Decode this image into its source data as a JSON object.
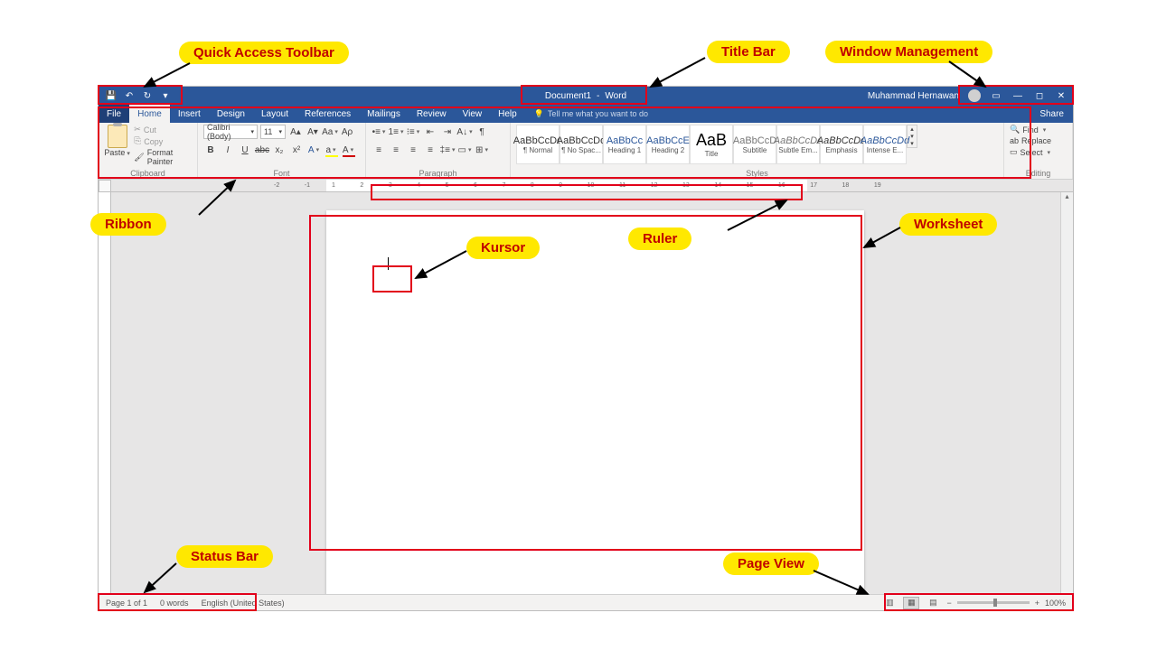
{
  "titlebar": {
    "doc_title": "Document1",
    "app_name": "Word",
    "user": "Muhammad Hernawan"
  },
  "tabs": {
    "file": "File",
    "home": "Home",
    "insert": "Insert",
    "design": "Design",
    "layout": "Layout",
    "references": "References",
    "mailings": "Mailings",
    "review": "Review",
    "view": "View",
    "help": "Help",
    "tellme": "Tell me what you want to do",
    "share": "Share"
  },
  "ribbon": {
    "clipboard": {
      "paste": "Paste",
      "cut": "Cut",
      "copy": "Copy",
      "format_painter": "Format Painter",
      "label": "Clipboard"
    },
    "font": {
      "name": "Calibri (Body)",
      "size": "11",
      "label": "Font"
    },
    "paragraph": {
      "label": "Paragraph"
    },
    "styles": {
      "label": "Styles",
      "items": [
        {
          "sample": "AaBbCcDd",
          "name": "¶ Normal"
        },
        {
          "sample": "AaBbCcDd",
          "name": "¶ No Spac..."
        },
        {
          "sample": "AaBbCc",
          "name": "Heading 1"
        },
        {
          "sample": "AaBbCcE",
          "name": "Heading 2"
        },
        {
          "sample": "AaB",
          "name": "Title"
        },
        {
          "sample": "AaBbCcD",
          "name": "Subtitle"
        },
        {
          "sample": "AaBbCcDd",
          "name": "Subtle Em..."
        },
        {
          "sample": "AaBbCcDd",
          "name": "Emphasis"
        },
        {
          "sample": "AaBbCcDd",
          "name": "Intense E..."
        }
      ]
    },
    "editing": {
      "find": "Find",
      "replace": "Replace",
      "select": "Select",
      "label": "Editing"
    }
  },
  "ruler": {
    "neg": [
      "-2",
      "-1"
    ],
    "pos": [
      "1",
      "2",
      "3",
      "4",
      "5",
      "6",
      "7",
      "8",
      "9",
      "10",
      "11",
      "12",
      "13",
      "14",
      "15",
      "16",
      "17",
      "18",
      "19"
    ]
  },
  "statusbar": {
    "page": "Page 1 of 1",
    "words": "0 words",
    "lang": "English (United States)",
    "zoom": "100%"
  },
  "callouts": {
    "qat": "Quick Access Toolbar",
    "titlebar": "Title Bar",
    "winmgmt": "Window Management",
    "ribbon": "Ribbon",
    "ruler": "Ruler",
    "worksheet": "Worksheet",
    "kursor": "Kursor",
    "statusbar": "Status Bar",
    "pageview": "Page View"
  }
}
